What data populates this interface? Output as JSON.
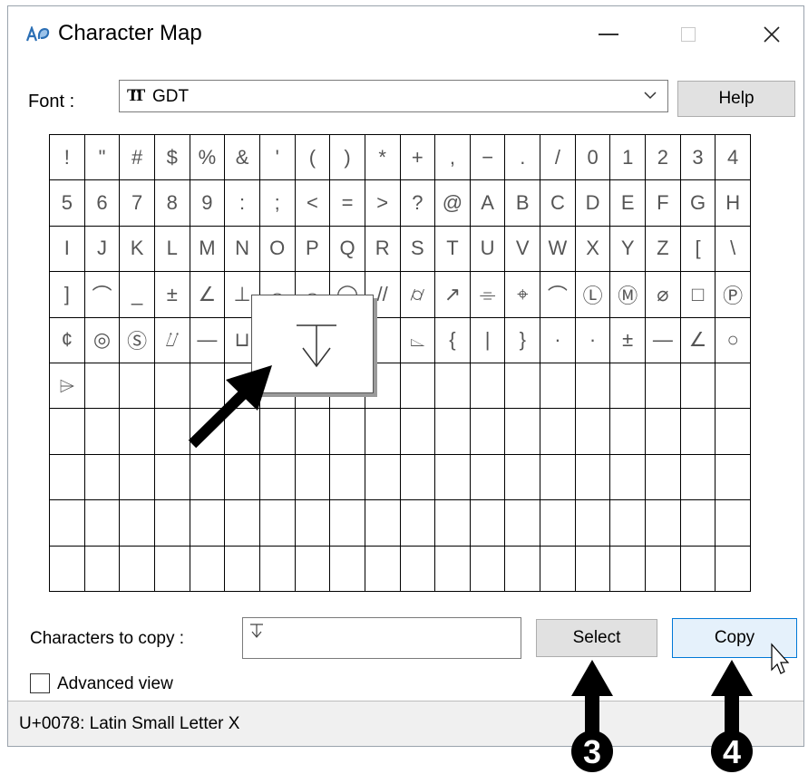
{
  "window": {
    "title": "Character Map"
  },
  "font": {
    "label": "Font :",
    "value": "GDT"
  },
  "buttons": {
    "help": "Help",
    "select": "Select",
    "copy": "Copy"
  },
  "characters_to_copy": {
    "label": "Characters to copy :",
    "value": "⊽"
  },
  "advanced_view": {
    "label": "Advanced view",
    "checked": false
  },
  "status": "U+0078: Latin Small Letter X",
  "grid": {
    "columns": 20,
    "rows": 10,
    "cells": [
      "!",
      "\"",
      "#",
      "$",
      "%",
      "&",
      "'",
      "(",
      ")",
      "*",
      "+",
      ",",
      "−",
      ".",
      "/",
      "0",
      "1",
      "2",
      "3",
      "4",
      "5",
      "6",
      "7",
      "8",
      "9",
      ":",
      ";",
      "<",
      "=",
      ">",
      "?",
      "@",
      "A",
      "B",
      "C",
      "D",
      "E",
      "F",
      "G",
      "H",
      "I",
      "J",
      "K",
      "L",
      "M",
      "N",
      "O",
      "P",
      "Q",
      "R",
      "S",
      "T",
      "U",
      "V",
      "W",
      "X",
      "Y",
      "Z",
      "[",
      "\\",
      "]",
      "⌒",
      "_",
      "±",
      "∠",
      "⊥",
      "⌓",
      "⌓",
      "◯",
      "//",
      "⌭",
      "↗",
      "⌯",
      "⌖",
      "⌒",
      "Ⓛ",
      "Ⓜ",
      "⌀",
      "□",
      "Ⓟ",
      "¢",
      "◎",
      "Ⓢ",
      "⌰",
      "—",
      "⊔",
      "",
      "",
      "",
      "",
      "⌳",
      "{",
      "|",
      "}",
      "·",
      "·",
      "±",
      "—",
      "∠",
      "○",
      "⌲"
    ]
  },
  "magnified": {
    "glyph": "⊽"
  },
  "annotations": {
    "badge_3": "3",
    "badge_4": "4"
  },
  "colors": {
    "copy_button_border": "#0078d7",
    "arrow": "#000000"
  }
}
